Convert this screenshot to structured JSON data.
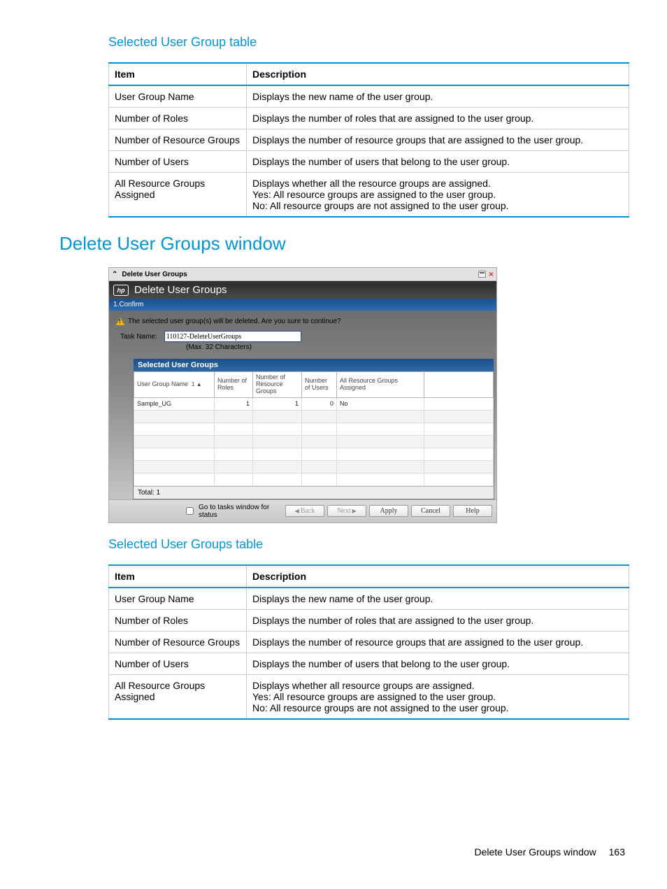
{
  "section1_title": "Selected User Group table",
  "table1": {
    "headers": {
      "item": "Item",
      "desc": "Description"
    },
    "rows": [
      {
        "item": "User Group Name",
        "desc": [
          "Displays the new name of the user group."
        ]
      },
      {
        "item": "Number of Roles",
        "desc": [
          "Displays the number of roles that are assigned to the user group."
        ]
      },
      {
        "item": "Number of Resource Groups",
        "desc": [
          "Displays the number of resource groups that are assigned to the user group."
        ]
      },
      {
        "item": "Number of Users",
        "desc": [
          "Displays the number of users that belong to the user group."
        ]
      },
      {
        "item": "All Resource Groups Assigned",
        "desc": [
          "Displays whether all the resource groups are assigned.",
          "Yes: All resource groups are assigned to the user group.",
          "No: All resource groups are not assigned to the user group."
        ]
      }
    ]
  },
  "section2_title": "Delete User Groups window",
  "screenshot": {
    "titlebar": "Delete User Groups",
    "header_title": "Delete User Groups",
    "step": "1.Confirm",
    "warning": "The selected user group(s) will be deleted. Are you sure to continue?",
    "task_label": "Task Name:",
    "task_value": "110127-DeleteUserGroups",
    "task_hint": "(Max. 32 Characters)",
    "grid_title": "Selected User Groups",
    "grid_headers": {
      "name": "User Group Name",
      "sort": "1 ▲",
      "roles": "Number of Roles",
      "rg": "Number of Resource Groups",
      "users": "Number of Users",
      "assigned": "All Resource Groups Assigned"
    },
    "grid_rows": [
      {
        "name": "Sample_UG",
        "roles": "1",
        "rg": "1",
        "users": "0",
        "assigned": "No"
      }
    ],
    "grid_total": "Total: 1",
    "footer": {
      "checkbox": "Go to tasks window for status",
      "back": "Back",
      "next": "Next",
      "apply": "Apply",
      "cancel": "Cancel",
      "help": "Help"
    }
  },
  "section3_title": "Selected User Groups table",
  "table2": {
    "headers": {
      "item": "Item",
      "desc": "Description"
    },
    "rows": [
      {
        "item": "User Group Name",
        "desc": [
          "Displays the new name of the user group."
        ]
      },
      {
        "item": "Number of Roles",
        "desc": [
          "Displays the number of roles that are assigned to the user group."
        ]
      },
      {
        "item": "Number of Resource Groups",
        "desc": [
          "Displays the number of resource groups that are assigned to the user group."
        ]
      },
      {
        "item": "Number of Users",
        "desc": [
          "Displays the number of users that belong to the user group."
        ]
      },
      {
        "item": "All Resource Groups Assigned",
        "desc": [
          "Displays whether all resource groups are assigned.",
          "Yes: All resource groups are assigned to the user group.",
          "No: All resource groups are not assigned to the user group."
        ]
      }
    ]
  },
  "footer": {
    "text": "Delete User Groups window",
    "page": "163"
  }
}
